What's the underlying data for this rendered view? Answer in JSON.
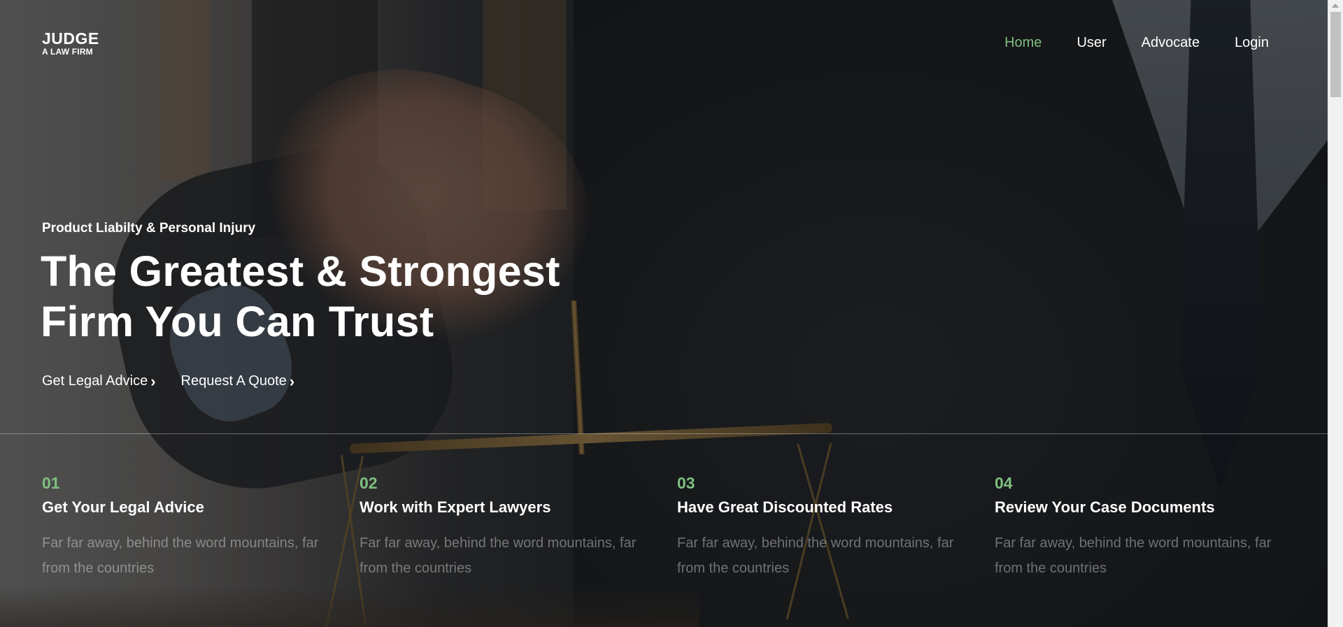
{
  "brand": {
    "title": "JUDGE",
    "subtitle": "A LAW FIRM"
  },
  "nav": {
    "items": [
      {
        "label": "Home",
        "active": true
      },
      {
        "label": "User",
        "active": false
      },
      {
        "label": "Advocate",
        "active": false
      },
      {
        "label": "Login",
        "active": false
      }
    ]
  },
  "hero": {
    "subtitle": "Product Liabilty & Personal Injury",
    "title_line1": "The Greatest & Strongest",
    "title_line2": "Firm You Can Trust",
    "cta_primary": "Get Legal Advice",
    "cta_secondary": "Request A Quote",
    "cta_icon": "chevron-right-icon"
  },
  "features": [
    {
      "number": "01",
      "title": "Get Your Legal Advice",
      "description": "Far far away, behind the word mountains, far from the countries"
    },
    {
      "number": "02",
      "title": "Work with Expert Lawyers",
      "description": "Far far away, behind the word mountains, far from the countries"
    },
    {
      "number": "03",
      "title": "Have Great Discounted Rates",
      "description": "Far far away, behind the word mountains, far from the countries"
    },
    {
      "number": "04",
      "title": "Review Your Case Documents",
      "description": "Far far away, behind the word mountains, far from the countries"
    }
  ],
  "colors": {
    "accent": "#7fbf7f",
    "text": "#ffffff",
    "muted_text": "rgba(255,255,255,0.38)"
  }
}
